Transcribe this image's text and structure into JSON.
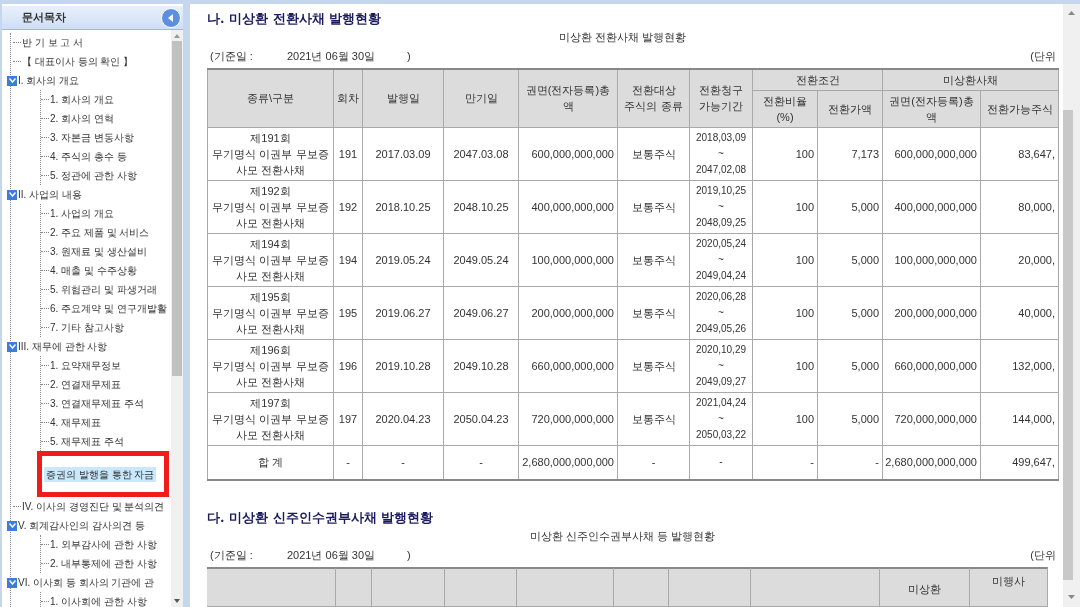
{
  "sidebar": {
    "title": "문서목차",
    "tree": [
      {
        "label": "반 기 보 고 서",
        "selected": false
      },
      {
        "label": "【 대표이사 등의 확인 】",
        "selected": false
      },
      {
        "label": "I. 회사의 개요",
        "selected": false,
        "expanded": true,
        "children": [
          {
            "label": "1. 회사의 개요",
            "selected": false
          },
          {
            "label": "2. 회사의 연혁",
            "selected": false
          },
          {
            "label": "3. 자본금 변동사항",
            "selected": false
          },
          {
            "label": "4. 주식의 총수 등",
            "selected": false
          },
          {
            "label": "5. 정관에 관한 사항",
            "selected": false
          }
        ]
      },
      {
        "label": "II. 사업의 내용",
        "selected": false,
        "expanded": true,
        "children": [
          {
            "label": "1. 사업의 개요",
            "selected": false
          },
          {
            "label": "2. 주요 제품 및 서비스",
            "selected": false
          },
          {
            "label": "3. 원재료 및 생산설비",
            "selected": false
          },
          {
            "label": "4. 매출 및 수주상황",
            "selected": false
          },
          {
            "label": "5. 위험관리 및 파생거래",
            "selected": false
          },
          {
            "label": "6. 주요계약 및 연구개발활",
            "selected": false
          },
          {
            "label": "7. 기타 참고사항",
            "selected": false
          }
        ]
      },
      {
        "label": "III. 재무에 관한 사항",
        "selected": false,
        "expanded": true,
        "children": [
          {
            "label": "1. 요약재무정보",
            "selected": false
          },
          {
            "label": "2. 연결재무제표",
            "selected": false
          },
          {
            "label": "3. 연결재무제표 주석",
            "selected": false
          },
          {
            "label": "4. 재무제표",
            "selected": false
          },
          {
            "label": "5. 재무제표 주석",
            "selected": false
          },
          {
            "label": "증권의 발행을 통한 자금",
            "selected": true
          }
        ]
      },
      {
        "label": "IV. 이사의 경영진단 및 분석의견",
        "selected": false
      },
      {
        "label": "V. 회계감사인의 감사의견 등",
        "selected": false,
        "expanded": true,
        "children": [
          {
            "label": "1. 외부감사에 관한 사항",
            "selected": false
          },
          {
            "label": "2. 내부통제에 관한 사항",
            "selected": false
          }
        ]
      },
      {
        "label": "VI. 이사회 등 회사의 기관에 관",
        "selected": false,
        "expanded": true,
        "children": [
          {
            "label": "1. 이사회에 관한 사항",
            "selected": false
          }
        ]
      }
    ]
  },
  "sections": [
    {
      "kind": "full-table",
      "title": "나. 미상환 전환사채 발행현황",
      "caption": "미상환 전환사채 발행현황",
      "date_label": "(기준일 :",
      "date": "2021년 06월 30일",
      "date_close": ")",
      "unit": "(단위",
      "header": [
        {
          "kind": "single",
          "text": "종류\\구분"
        },
        {
          "kind": "single",
          "text": "회차"
        },
        {
          "kind": "single",
          "text": "발행일"
        },
        {
          "kind": "single",
          "text": "만기일"
        },
        {
          "kind": "single",
          "text": "권면(전자등록)총\n액"
        },
        {
          "kind": "single",
          "text": "전환대상\n주식의 종류"
        },
        {
          "kind": "single",
          "text": "전환청구\n가능기간"
        },
        {
          "kind": "group",
          "text": "전환조건",
          "children": [
            "전환비율\n(%)",
            "전환가액"
          ]
        },
        {
          "kind": "group",
          "text": "미상환사채",
          "children": [
            "권면(전자등록)총\n액",
            "전환가능주식"
          ]
        }
      ],
      "rows": [
        {
          "kind": "item",
          "cells": [
            "제191회\n무기명식 이권부 무보증\n사모 전환사채",
            "191",
            "2017.03.09",
            "2047.03.08",
            "600,000,000,000",
            "보통주식",
            "2018,03,09\n~\n2047,02,08",
            "100",
            "7,173",
            "600,000,000,000",
            "83,647,"
          ]
        },
        {
          "kind": "item",
          "cells": [
            "제192회\n무기명식 이권부 무보증\n사모 전환사채",
            "192",
            "2018.10.25",
            "2048.10.25",
            "400,000,000,000",
            "보통주식",
            "2019,10,25\n~\n2048,09,25",
            "100",
            "5,000",
            "400,000,000,000",
            "80,000,"
          ]
        },
        {
          "kind": "item",
          "cells": [
            "제194회\n무기명식 이권부 무보증\n사모 전환사채",
            "194",
            "2019.05.24",
            "2049.05.24",
            "100,000,000,000",
            "보통주식",
            "2020,05,24\n~\n2049,04,24",
            "100",
            "5,000",
            "100,000,000,000",
            "20,000,"
          ]
        },
        {
          "kind": "item",
          "cells": [
            "제195회\n무기명식 이권부 무보증\n사모 전환사채",
            "195",
            "2019.06.27",
            "2049.06.27",
            "200,000,000,000",
            "보통주식",
            "2020,06,28\n~\n2049,05,26",
            "100",
            "5,000",
            "200,000,000,000",
            "40,000,"
          ]
        },
        {
          "kind": "item",
          "cells": [
            "제196회\n무기명식 이권부 무보증\n사모 전환사채",
            "196",
            "2019.10.28",
            "2049.10.28",
            "660,000,000,000",
            "보통주식",
            "2020,10,29\n~\n2049,09,27",
            "100",
            "5,000",
            "660,000,000,000",
            "132,000,"
          ]
        },
        {
          "kind": "item",
          "cells": [
            "제197회\n무기명식 이권부 무보증\n사모 전환사채",
            "197",
            "2020.04.23",
            "2050.04.23",
            "720,000,000,000",
            "보통주식",
            "2021,04,24\n~\n2050,03,22",
            "100",
            "5,000",
            "720,000,000,000",
            "144,000,"
          ]
        },
        {
          "kind": "total",
          "cells": [
            "합 계",
            "-",
            "-",
            "-",
            "2,680,000,000,000",
            "-",
            "-",
            "-",
            "-",
            "2,680,000,000,000",
            "499,647,"
          ]
        }
      ]
    },
    {
      "kind": "header-only",
      "title": "다. 미상환 신주인수권부사채 발행현황",
      "caption": "미상환 신주인수권부사채 등 발행현황",
      "date_label": "(기준일 :",
      "date": "2021년 06월 30일",
      "date_close": ")",
      "unit": "(단위",
      "header_cells": [
        {
          "kind": "blank"
        },
        {
          "kind": "blank"
        },
        {
          "kind": "blank"
        },
        {
          "kind": "blank"
        },
        {
          "kind": "blank"
        },
        {
          "kind": "blank"
        },
        {
          "kind": "blank"
        },
        {
          "kind": "blank"
        },
        {
          "kind": "text",
          "text": "미상환"
        },
        {
          "kind": "text",
          "text": "미행사"
        }
      ]
    }
  ]
}
